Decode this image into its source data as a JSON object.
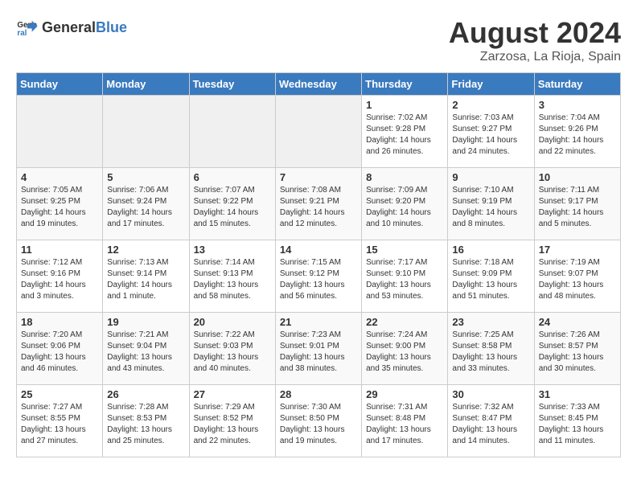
{
  "header": {
    "logo_general": "General",
    "logo_blue": "Blue",
    "month_year": "August 2024",
    "location": "Zarzosa, La Rioja, Spain"
  },
  "weekdays": [
    "Sunday",
    "Monday",
    "Tuesday",
    "Wednesday",
    "Thursday",
    "Friday",
    "Saturday"
  ],
  "weeks": [
    [
      {
        "day": "",
        "info": ""
      },
      {
        "day": "",
        "info": ""
      },
      {
        "day": "",
        "info": ""
      },
      {
        "day": "",
        "info": ""
      },
      {
        "day": "1",
        "info": "Sunrise: 7:02 AM\nSunset: 9:28 PM\nDaylight: 14 hours\nand 26 minutes."
      },
      {
        "day": "2",
        "info": "Sunrise: 7:03 AM\nSunset: 9:27 PM\nDaylight: 14 hours\nand 24 minutes."
      },
      {
        "day": "3",
        "info": "Sunrise: 7:04 AM\nSunset: 9:26 PM\nDaylight: 14 hours\nand 22 minutes."
      }
    ],
    [
      {
        "day": "4",
        "info": "Sunrise: 7:05 AM\nSunset: 9:25 PM\nDaylight: 14 hours\nand 19 minutes."
      },
      {
        "day": "5",
        "info": "Sunrise: 7:06 AM\nSunset: 9:24 PM\nDaylight: 14 hours\nand 17 minutes."
      },
      {
        "day": "6",
        "info": "Sunrise: 7:07 AM\nSunset: 9:22 PM\nDaylight: 14 hours\nand 15 minutes."
      },
      {
        "day": "7",
        "info": "Sunrise: 7:08 AM\nSunset: 9:21 PM\nDaylight: 14 hours\nand 12 minutes."
      },
      {
        "day": "8",
        "info": "Sunrise: 7:09 AM\nSunset: 9:20 PM\nDaylight: 14 hours\nand 10 minutes."
      },
      {
        "day": "9",
        "info": "Sunrise: 7:10 AM\nSunset: 9:19 PM\nDaylight: 14 hours\nand 8 minutes."
      },
      {
        "day": "10",
        "info": "Sunrise: 7:11 AM\nSunset: 9:17 PM\nDaylight: 14 hours\nand 5 minutes."
      }
    ],
    [
      {
        "day": "11",
        "info": "Sunrise: 7:12 AM\nSunset: 9:16 PM\nDaylight: 14 hours\nand 3 minutes."
      },
      {
        "day": "12",
        "info": "Sunrise: 7:13 AM\nSunset: 9:14 PM\nDaylight: 14 hours\nand 1 minute."
      },
      {
        "day": "13",
        "info": "Sunrise: 7:14 AM\nSunset: 9:13 PM\nDaylight: 13 hours\nand 58 minutes."
      },
      {
        "day": "14",
        "info": "Sunrise: 7:15 AM\nSunset: 9:12 PM\nDaylight: 13 hours\nand 56 minutes."
      },
      {
        "day": "15",
        "info": "Sunrise: 7:17 AM\nSunset: 9:10 PM\nDaylight: 13 hours\nand 53 minutes."
      },
      {
        "day": "16",
        "info": "Sunrise: 7:18 AM\nSunset: 9:09 PM\nDaylight: 13 hours\nand 51 minutes."
      },
      {
        "day": "17",
        "info": "Sunrise: 7:19 AM\nSunset: 9:07 PM\nDaylight: 13 hours\nand 48 minutes."
      }
    ],
    [
      {
        "day": "18",
        "info": "Sunrise: 7:20 AM\nSunset: 9:06 PM\nDaylight: 13 hours\nand 46 minutes."
      },
      {
        "day": "19",
        "info": "Sunrise: 7:21 AM\nSunset: 9:04 PM\nDaylight: 13 hours\nand 43 minutes."
      },
      {
        "day": "20",
        "info": "Sunrise: 7:22 AM\nSunset: 9:03 PM\nDaylight: 13 hours\nand 40 minutes."
      },
      {
        "day": "21",
        "info": "Sunrise: 7:23 AM\nSunset: 9:01 PM\nDaylight: 13 hours\nand 38 minutes."
      },
      {
        "day": "22",
        "info": "Sunrise: 7:24 AM\nSunset: 9:00 PM\nDaylight: 13 hours\nand 35 minutes."
      },
      {
        "day": "23",
        "info": "Sunrise: 7:25 AM\nSunset: 8:58 PM\nDaylight: 13 hours\nand 33 minutes."
      },
      {
        "day": "24",
        "info": "Sunrise: 7:26 AM\nSunset: 8:57 PM\nDaylight: 13 hours\nand 30 minutes."
      }
    ],
    [
      {
        "day": "25",
        "info": "Sunrise: 7:27 AM\nSunset: 8:55 PM\nDaylight: 13 hours\nand 27 minutes."
      },
      {
        "day": "26",
        "info": "Sunrise: 7:28 AM\nSunset: 8:53 PM\nDaylight: 13 hours\nand 25 minutes."
      },
      {
        "day": "27",
        "info": "Sunrise: 7:29 AM\nSunset: 8:52 PM\nDaylight: 13 hours\nand 22 minutes."
      },
      {
        "day": "28",
        "info": "Sunrise: 7:30 AM\nSunset: 8:50 PM\nDaylight: 13 hours\nand 19 minutes."
      },
      {
        "day": "29",
        "info": "Sunrise: 7:31 AM\nSunset: 8:48 PM\nDaylight: 13 hours\nand 17 minutes."
      },
      {
        "day": "30",
        "info": "Sunrise: 7:32 AM\nSunset: 8:47 PM\nDaylight: 13 hours\nand 14 minutes."
      },
      {
        "day": "31",
        "info": "Sunrise: 7:33 AM\nSunset: 8:45 PM\nDaylight: 13 hours\nand 11 minutes."
      }
    ]
  ]
}
